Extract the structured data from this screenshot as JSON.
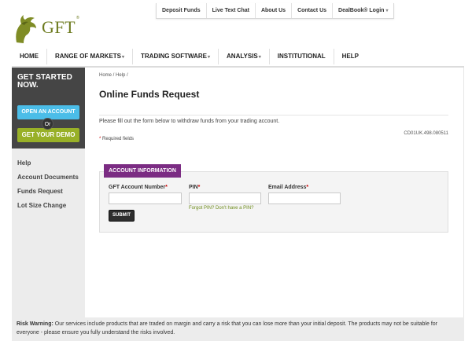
{
  "brand": {
    "logo_text": "GFT",
    "logo_mark": "®",
    "logo_color": "#6c7a1e"
  },
  "top_nav": {
    "items": [
      "Deposit Funds",
      "Live Text Chat",
      "About Us",
      "Contact Us"
    ],
    "login_label": "DealBook® Login"
  },
  "main_nav": {
    "items": [
      {
        "label": "HOME",
        "dropdown": false
      },
      {
        "label": "RANGE OF MARKETS",
        "dropdown": true
      },
      {
        "label": "TRADING SOFTWARE",
        "dropdown": true
      },
      {
        "label": "ANALYSIS",
        "dropdown": true
      },
      {
        "label": "INSTITUTIONAL",
        "dropdown": false
      },
      {
        "label": "HELP",
        "dropdown": false
      }
    ]
  },
  "sidebar": {
    "promo_title": "GET STARTED NOW.",
    "open_account_label": "OPEN AN ACCOUNT",
    "or_label": "Or",
    "demo_label": "GET YOUR DEMO",
    "links": [
      "Help",
      "Account Documents",
      "Funds Request",
      "Lot Size Change"
    ]
  },
  "page": {
    "breadcrumb": "Home / Help /",
    "title": "Online Funds Request",
    "intro": "Please fill out the form below to withdraw funds from your trading account.",
    "reference": "CD01UK.498.080511",
    "required_note": "Required fields"
  },
  "form": {
    "section_title": "ACCOUNT INFORMATION",
    "account_label": "GFT Account Number",
    "account_value": "",
    "pin_label": "PIN",
    "pin_value": "",
    "email_label": "Email Address",
    "email_value": "",
    "forgot_link": "Forgot PIN? Don't have a PIN?",
    "submit_label": "SUBMIT"
  },
  "footer": {
    "warning_label": "Risk Warning:",
    "warning_text": " Our services include products that are traded on margin and carry a risk that you can lose more than your initial deposit. The products may not be suitable for everyone - please ensure you fully understand the risks involved."
  },
  "colors": {
    "accent_purple": "#7b2c83",
    "open_account_blue": "#4bbde8",
    "demo_green": "#98b027",
    "sidebar_dark": "#454545"
  }
}
